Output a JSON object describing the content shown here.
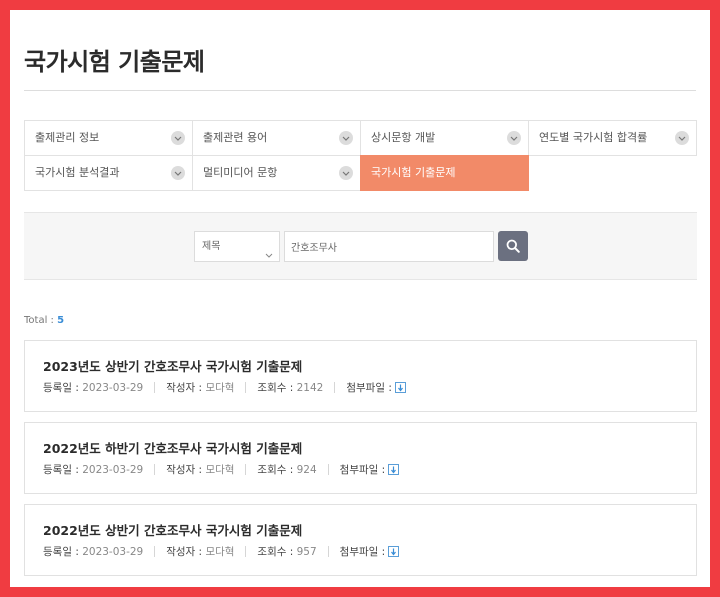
{
  "page": {
    "title": "국가시험 기출문제"
  },
  "menu": {
    "items": [
      {
        "label": "출제관리 정보"
      },
      {
        "label": "출제관련 용어"
      },
      {
        "label": "상시문항 개발"
      },
      {
        "label": "연도별 국가시험 합격률"
      },
      {
        "label": "국가시험 분석결과"
      },
      {
        "label": "멀티미디어 문항"
      },
      {
        "label": "국가시험 기출문제"
      }
    ],
    "active_index": 6,
    "active_color": "#f28a68"
  },
  "search": {
    "select_value": "제목",
    "input_value": "간호조무사",
    "button_icon": "search-icon"
  },
  "total": {
    "label": "Total :",
    "count": "5"
  },
  "meta_labels": {
    "date": "등록일 :",
    "author": "작성자 :",
    "views": "조회수 :",
    "attachment": "첨부파일 :"
  },
  "posts": [
    {
      "title": "2023년도 상반기 간호조무사 국가시험 기출문제",
      "date": "2023-03-29",
      "author": "모다혁",
      "views": "2142"
    },
    {
      "title": "2022년도 하반기 간호조무사 국가시험 기출문제",
      "date": "2023-03-29",
      "author": "모다혁",
      "views": "924"
    },
    {
      "title": "2022년도 상반기 간호조무사 국가시험 기출문제",
      "date": "2023-03-29",
      "author": "모다혁",
      "views": "957"
    }
  ]
}
